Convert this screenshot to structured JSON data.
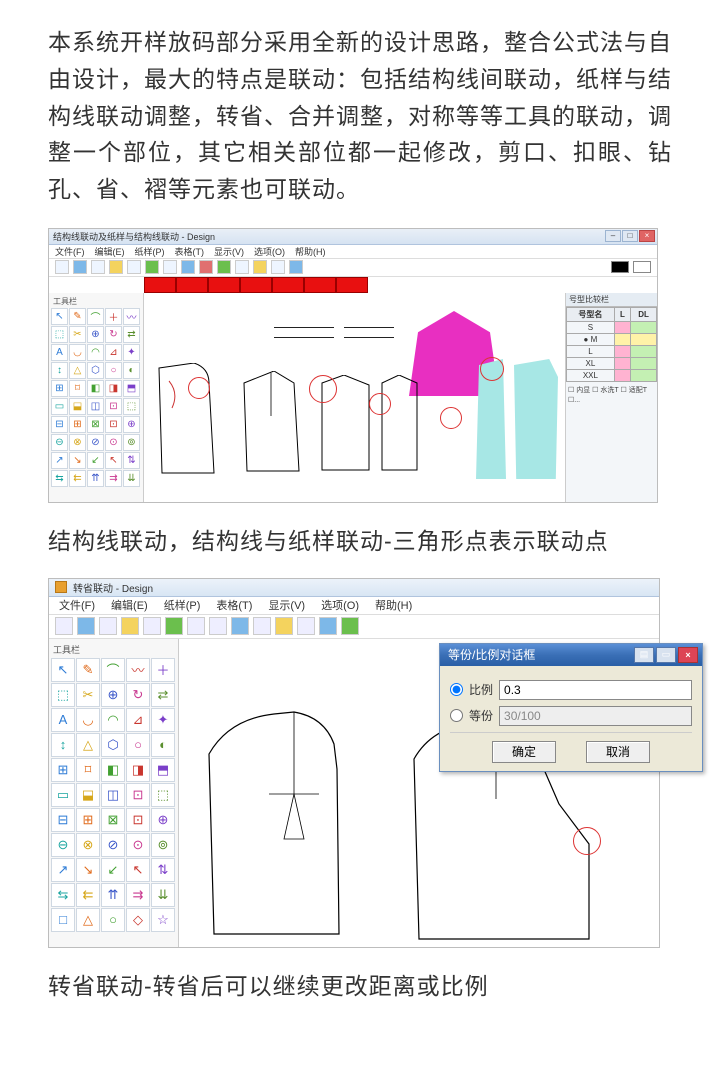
{
  "para1": "本系统开样放码部分采用全新的设计思路，整合公式法与自由设计，最大的特点是联动：包括结构线间联动，纸样与结构线联动调整，转省、合并调整，对称等等工具的联动，调整一个部位，其它相关部位都一起修改，剪口、扣眼、钻孔、省、褶等元素也可联动。",
  "caption1": "结构线联动，结构线与纸样联动-三角形点表示联动点",
  "caption2": "转省联动-转省后可以继续更改距离或比例",
  "shot1": {
    "title": "结构线联动及纸样与结构线联动 - Design",
    "menus": [
      "文件(F)",
      "编辑(E)",
      "纸样(P)",
      "表格(T)",
      "显示(V)",
      "选项(O)",
      "帮助(H)"
    ],
    "toolpanel_label": "工具栏",
    "sizepanel_label": "号型比较栏",
    "size_headers": [
      "号型名",
      "L",
      "DL"
    ],
    "size_rows": [
      "S",
      "M",
      "L",
      "XL",
      "XXL"
    ],
    "size_opts": "☐ 内显 ☐ 水洗T ☐ 适配T ☐..."
  },
  "shot2": {
    "title": "转省联动 - Design",
    "menus": [
      "文件(F)",
      "编辑(E)",
      "纸样(P)",
      "表格(T)",
      "显示(V)",
      "选项(O)",
      "帮助(H)"
    ],
    "toolpanel_label": "工具栏",
    "dialog": {
      "title": "等份/比例对话框",
      "opt1_label": "比例",
      "opt1_value": "0.3",
      "opt2_label": "等份",
      "opt2_value": "30/100",
      "ok": "确定",
      "cancel": "取消"
    }
  },
  "icons1": [
    "↖",
    "✎",
    "⌒",
    "＋",
    "〰",
    "⬚",
    "✂",
    "⊕",
    "↻",
    "⇄",
    "A",
    "◡",
    "◠",
    "⊿",
    "✦",
    "↕",
    "△",
    "⬡",
    "○",
    "◐",
    "⊞",
    "⌑",
    "◧",
    "◨",
    "⬒",
    "▭",
    "⬓",
    "◫",
    "⊡",
    "⬚",
    "⊟",
    "⊞",
    "⊠",
    "⊡",
    "⊕",
    "⊖",
    "⊗",
    "⊘",
    "⊙",
    "⊚",
    "↗",
    "↘",
    "↙",
    "↖",
    "⇅",
    "⇆",
    "⇇",
    "⇈",
    "⇉",
    "⇊"
  ],
  "icons2": [
    "↖",
    "✎",
    "⌒",
    "〰",
    "＋",
    "⬚",
    "✂",
    "⊕",
    "↻",
    "⇄",
    "A",
    "◡",
    "◠",
    "⊿",
    "✦",
    "↕",
    "△",
    "⬡",
    "○",
    "◐",
    "⊞",
    "⌑",
    "◧",
    "◨",
    "⬒",
    "▭",
    "⬓",
    "◫",
    "⊡",
    "⬚",
    "⊟",
    "⊞",
    "⊠",
    "⊡",
    "⊕",
    "⊖",
    "⊗",
    "⊘",
    "⊙",
    "⊚",
    "↗",
    "↘",
    "↙",
    "↖",
    "⇅",
    "⇆",
    "⇇",
    "⇈",
    "⇉",
    "⇊",
    "□",
    "△",
    "○",
    "◇",
    "☆"
  ],
  "toolcolors": [
    "#2e7cd6",
    "#e06a1a",
    "#42a031",
    "#c9362e",
    "#7b3fc9",
    "#1aa5a0",
    "#d6a71a",
    "#3956c9",
    "#c93990",
    "#5a8f2e",
    "#2e7cd6",
    "#e06a1a",
    "#42a031",
    "#c9362e",
    "#7b3fc9",
    "#1aa5a0",
    "#d6a71a",
    "#3956c9",
    "#c93990",
    "#5a8f2e"
  ]
}
